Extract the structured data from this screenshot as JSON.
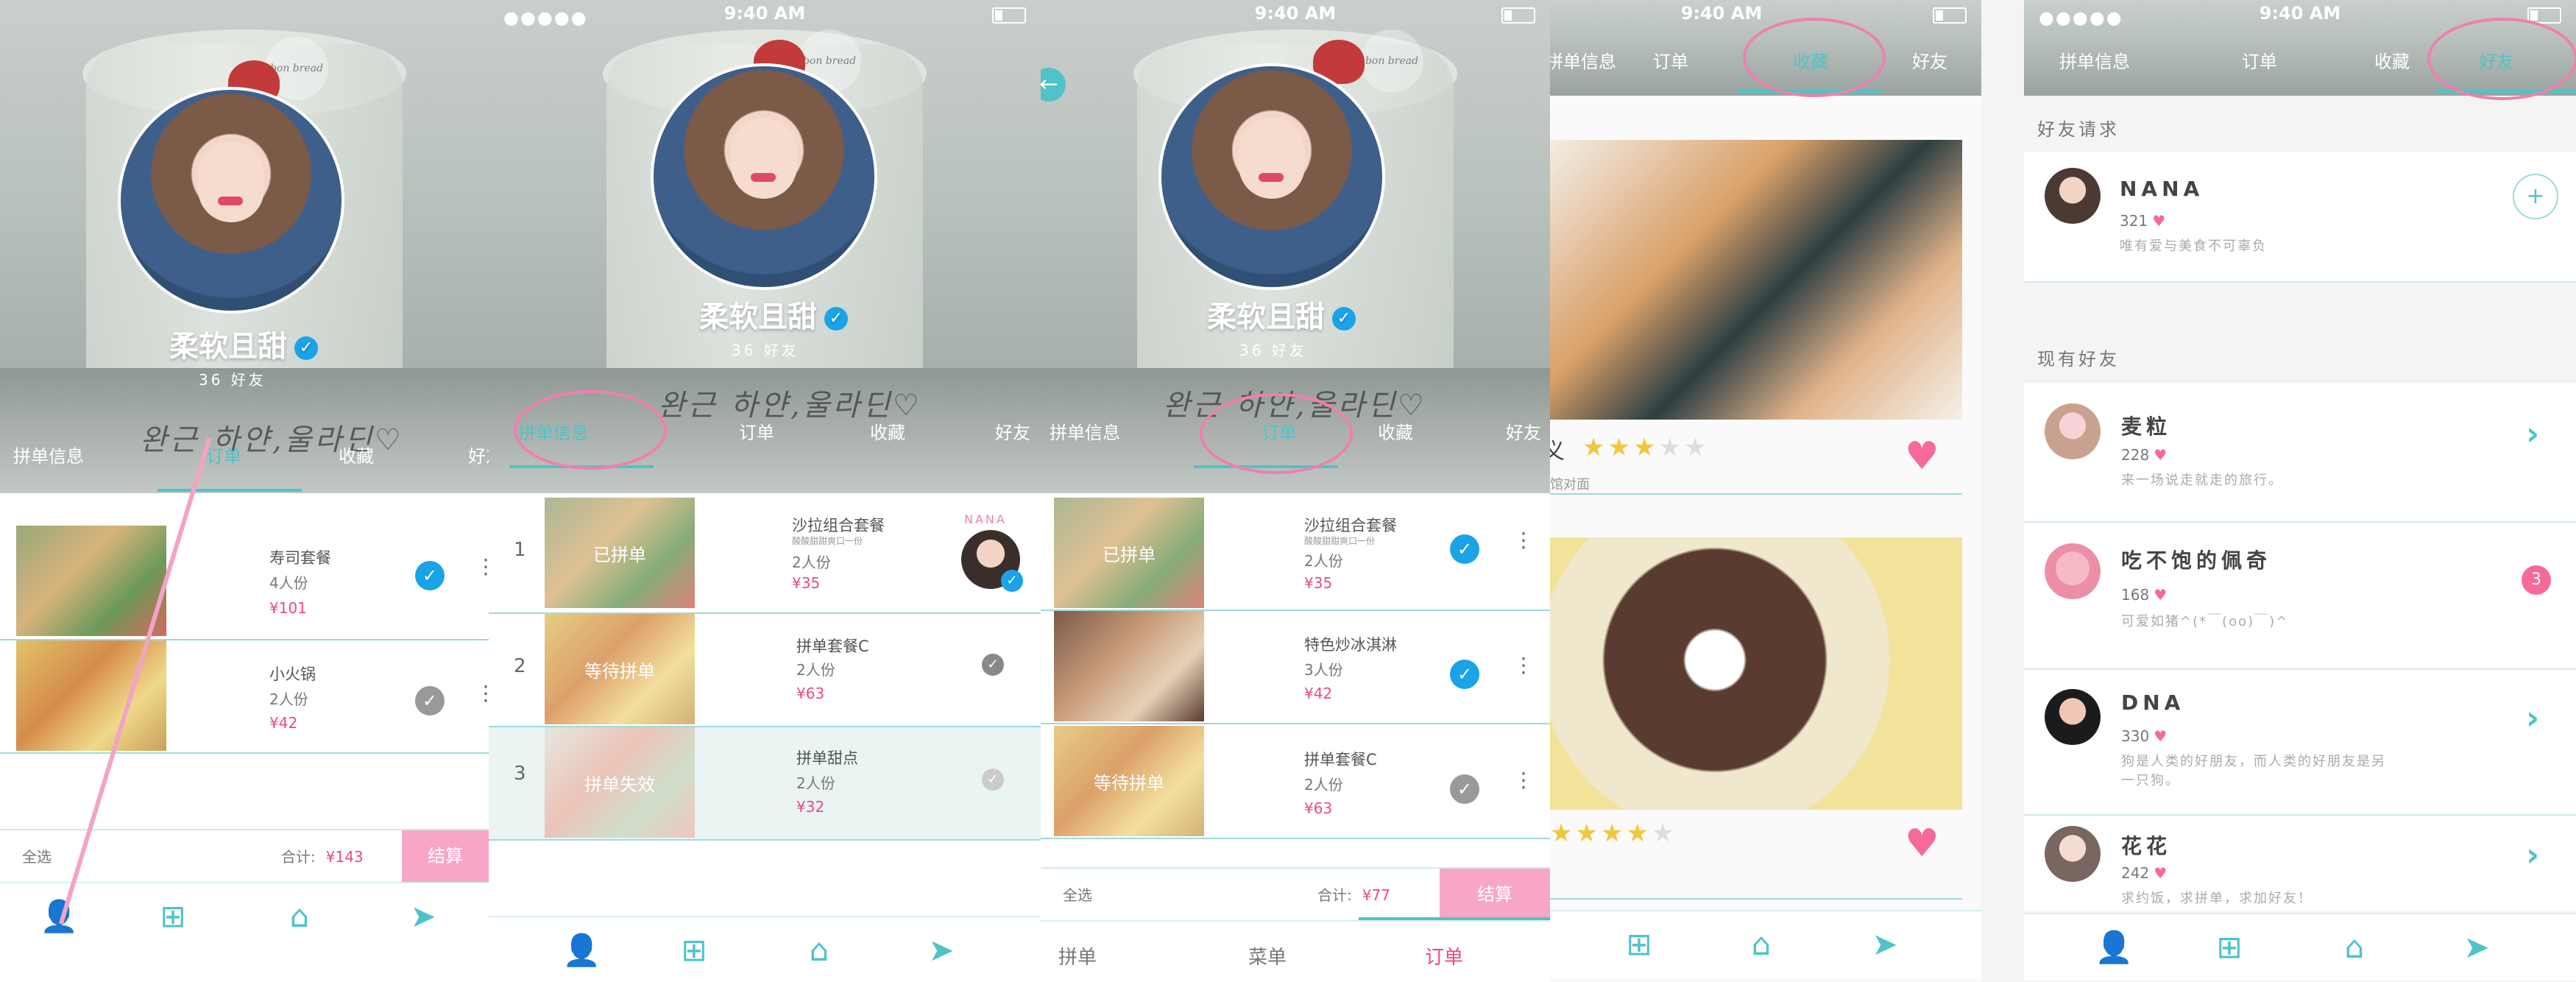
{
  "status": {
    "time": "9:40 AM",
    "dots": "●●●●●"
  },
  "profile": {
    "name": "柔软且甜",
    "friends": "36 好友",
    "stamp": "bon bread",
    "scribble": "완근 하얀,울라딘♡"
  },
  "tabs": {
    "pindan": "拼单信息",
    "order": "订单",
    "fav": "收藏",
    "friend": "好友"
  },
  "screen1": {
    "items": [
      {
        "name": "寿司套餐",
        "people": "4人份",
        "price": "¥101",
        "checked": true
      },
      {
        "name": "小火锅",
        "people": "2人份",
        "price": "¥42",
        "checked": false
      }
    ],
    "select_all": "全选",
    "total_label": "合计:",
    "total": "¥143",
    "pay": "结算"
  },
  "screen2": {
    "items": [
      {
        "index": "1",
        "status": "已拼单",
        "name": "沙拉组合套餐",
        "sub": "酸酸甜甜爽口一份",
        "people": "2人份",
        "price": "¥35"
      },
      {
        "index": "2",
        "status": "等待拼单",
        "name": "拼单套餐C",
        "people": "2人份",
        "price": "¥63"
      },
      {
        "index": "3",
        "status": "拼单失效",
        "name": "拼单甜点",
        "people": "2人份",
        "price": "¥32"
      }
    ],
    "seller": "NANA"
  },
  "screen3": {
    "items": [
      {
        "status": "已拼单",
        "name": "沙拉组合套餐",
        "sub": "酸酸甜甜爽口一份",
        "people": "2人份",
        "price": "¥35",
        "checked": true
      },
      {
        "status": "",
        "name": "特色炒冰淇淋",
        "people": "3人份",
        "price": "¥42",
        "checked": true
      },
      {
        "status": "等待拼单",
        "name": "拼单套餐C",
        "people": "2人份",
        "price": "¥63",
        "checked": false
      }
    ],
    "select_all": "全选",
    "total_label": "合计:",
    "total": "¥77",
    "pay": "结算",
    "nav": {
      "pindan": "拼单",
      "menu": "菜单",
      "order": "订单"
    }
  },
  "screen4": {
    "cards": [
      {
        "stars": 3,
        "caption": "馆对面",
        "title_fragment": "义"
      },
      {
        "stars": 4,
        "caption": ""
      }
    ]
  },
  "screen5": {
    "requests_title": "好友请求",
    "current_title": "现有好友",
    "requests": [
      {
        "name": "NANA",
        "count": "321",
        "msg": "唯有爱与美食不可辜负"
      }
    ],
    "friends": [
      {
        "name": "麦粒",
        "count": "228",
        "msg": "来一场说走就走的旅行。",
        "badge": ""
      },
      {
        "name": "吃不饱的佩奇",
        "count": "168",
        "msg": "可爱如猪^(*￣(oo)￣)^",
        "badge": "3"
      },
      {
        "name": "DNA",
        "count": "330",
        "msg": "狗是人类的好朋友，而人类的好朋友是另",
        "msg2": "一只狗。",
        "badge": ""
      },
      {
        "name": "花花",
        "count": "242",
        "msg": "求约饭，求拼单，求加好友！",
        "badge": ""
      }
    ]
  },
  "colors": {
    "accent": "#4fc3c8",
    "pink": "#ea4a86",
    "highlight": "#ef7fb0",
    "check": "#1aa3e6"
  }
}
